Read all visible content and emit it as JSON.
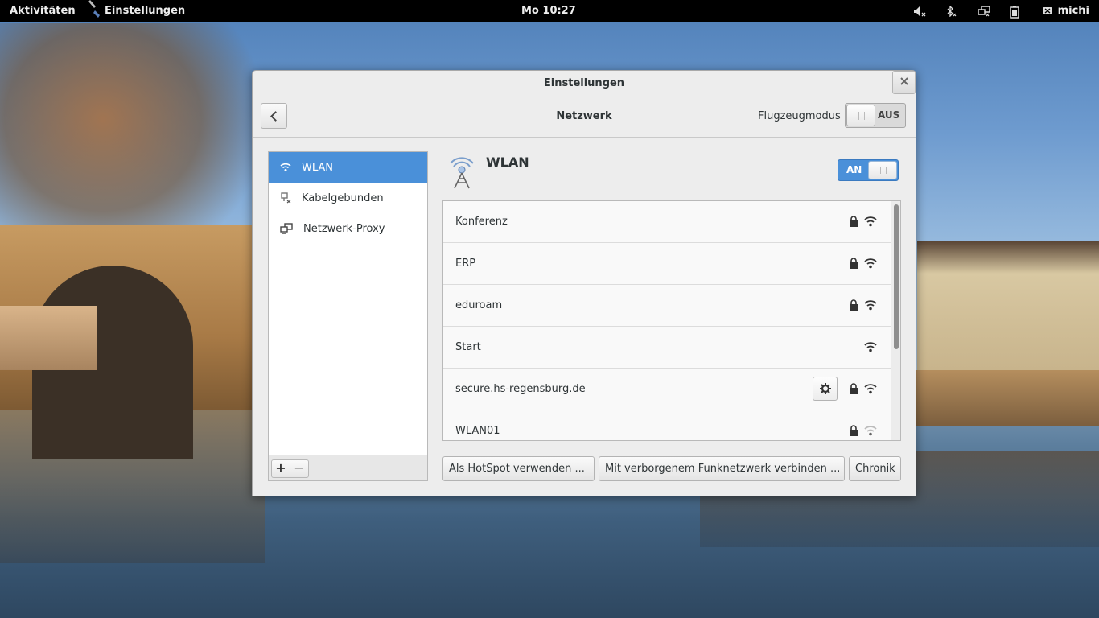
{
  "topbar": {
    "activities": "Aktivitäten",
    "app_menu": "Einstellungen",
    "clock": "Mo 10:27",
    "user": "michi",
    "tray_icons": [
      "volume-muted-icon",
      "bluetooth-disabled-icon",
      "network-icon",
      "battery-icon",
      "user-icon"
    ]
  },
  "window": {
    "title": "Einstellungen",
    "header": {
      "page_title": "Netzwerk",
      "airplane_label": "Flugzeugmodus",
      "airplane_state": "AUS"
    },
    "sidebar": {
      "items": [
        {
          "label": "WLAN",
          "icon": "wifi-icon",
          "active": true
        },
        {
          "label": "Kabelgebunden",
          "icon": "wired-disconnected-icon",
          "active": false
        },
        {
          "label": "Netzwerk-Proxy",
          "icon": "proxy-icon",
          "active": false
        }
      ],
      "add_label": "+",
      "remove_label": "−"
    },
    "main": {
      "title": "WLAN",
      "switch_state": "AN",
      "networks": [
        {
          "name": "Konferenz",
          "secured": true,
          "settings": false
        },
        {
          "name": "ERP",
          "secured": true,
          "settings": false
        },
        {
          "name": "eduroam",
          "secured": true,
          "settings": false
        },
        {
          "name": "Start",
          "secured": false,
          "settings": false
        },
        {
          "name": "secure.hs-regensburg.de",
          "secured": true,
          "settings": true
        },
        {
          "name": "WLAN01",
          "secured": true,
          "settings": false
        }
      ],
      "buttons": {
        "hotspot": "Als HotSpot verwenden ...",
        "hidden": "Mit verborgenem Funknetzwerk verbinden ...",
        "history": "Chronik"
      }
    }
  }
}
